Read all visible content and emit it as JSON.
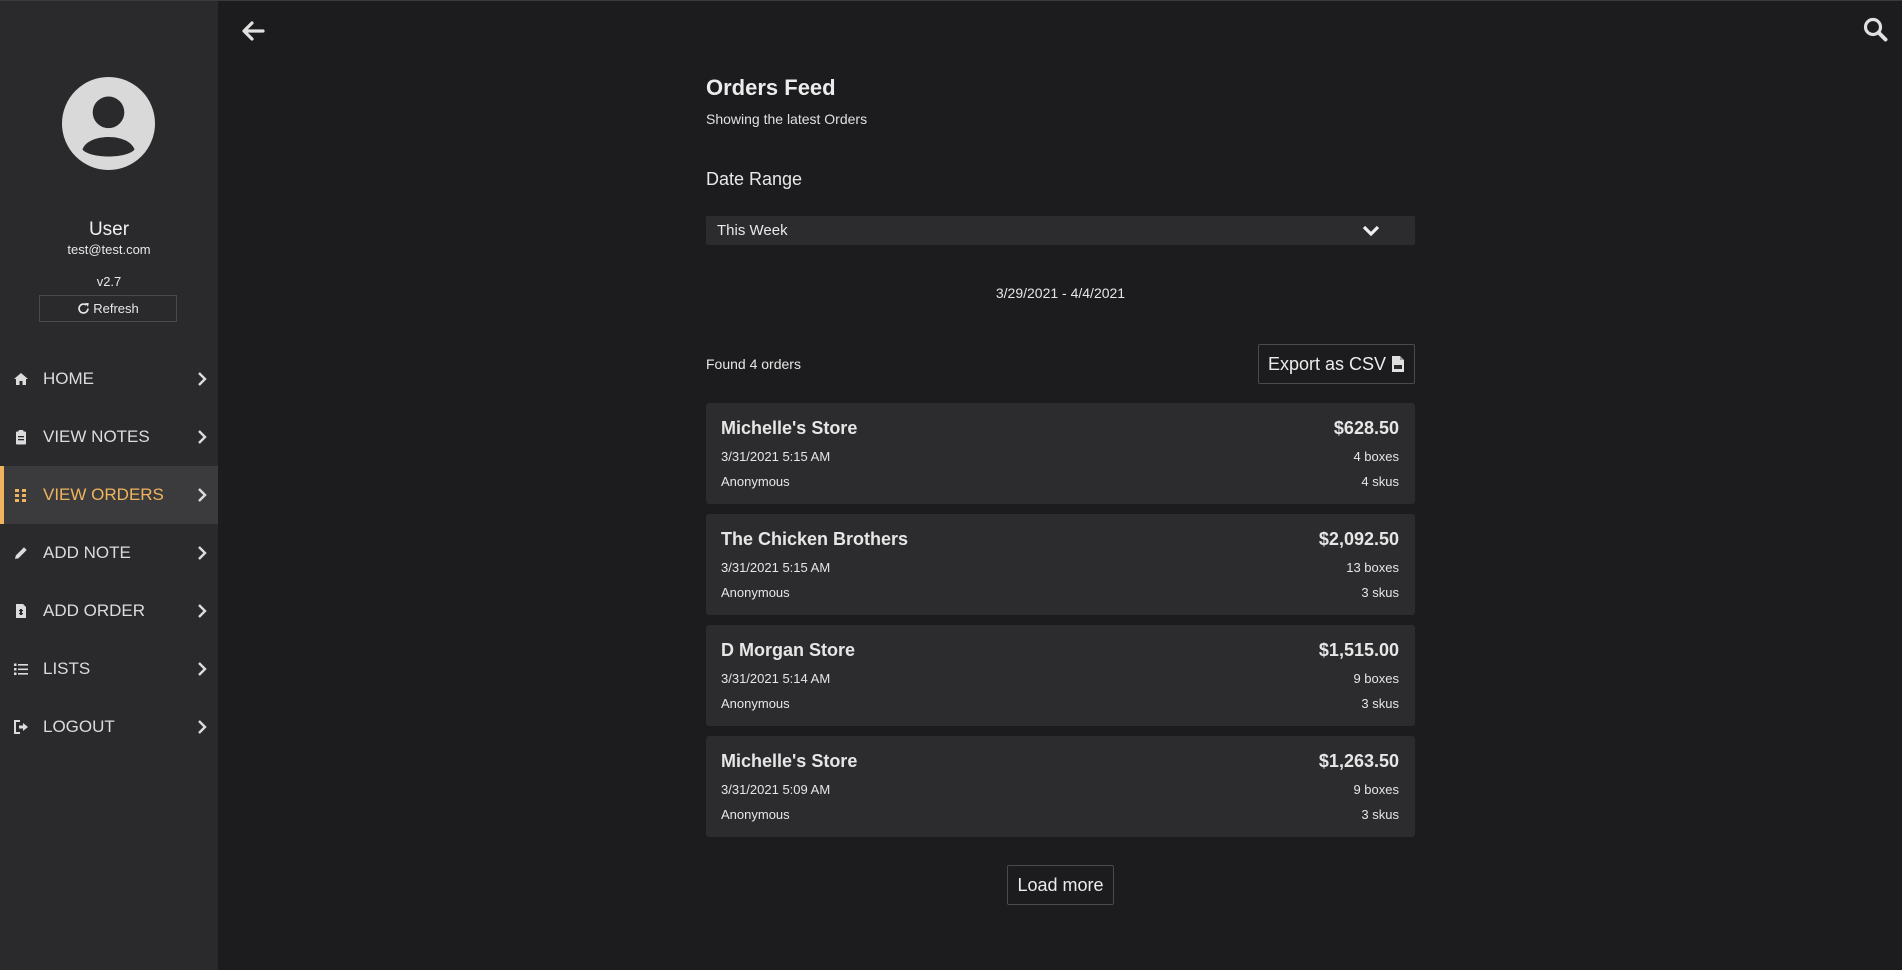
{
  "user": {
    "name": "User",
    "email": "test@test.com",
    "version": "v2.7",
    "refresh_label": "Refresh"
  },
  "nav": {
    "items": [
      {
        "label": "HOME",
        "icon": "home-icon"
      },
      {
        "label": "VIEW NOTES",
        "icon": "clipboard-icon"
      },
      {
        "label": "VIEW ORDERS",
        "icon": "grid-icon",
        "active": true
      },
      {
        "label": "ADD NOTE",
        "icon": "pencil-icon"
      },
      {
        "label": "ADD ORDER",
        "icon": "file-invoice-icon"
      },
      {
        "label": "LISTS",
        "icon": "list-icon"
      },
      {
        "label": "LOGOUT",
        "icon": "sign-out-icon"
      }
    ]
  },
  "header": {
    "back_icon": "arrow-left-icon",
    "search_icon": "search-icon"
  },
  "feed": {
    "title": "Orders Feed",
    "subtitle": "Showing the latest Orders",
    "date_range_label": "Date Range",
    "date_range_value": "This Week",
    "range_text": "3/29/2021 - 4/4/2021",
    "found_text": "Found 4 orders",
    "export_label": "Export as CSV",
    "load_more_label": "Load more"
  },
  "orders": [
    {
      "store": "Michelle's Store",
      "price": "$628.50",
      "date": "3/31/2021 5:15 AM",
      "boxes": "4 boxes",
      "author": "Anonymous",
      "skus": "4 skus"
    },
    {
      "store": "The Chicken Brothers",
      "price": "$2,092.50",
      "date": "3/31/2021 5:15 AM",
      "boxes": "13 boxes",
      "author": "Anonymous",
      "skus": "3 skus"
    },
    {
      "store": "D Morgan Store",
      "price": "$1,515.00",
      "date": "3/31/2021 5:14 AM",
      "boxes": "9 boxes",
      "author": "Anonymous",
      "skus": "3 skus"
    },
    {
      "store": "Michelle's Store",
      "price": "$1,263.50",
      "date": "3/31/2021 5:09 AM",
      "boxes": "9 boxes",
      "author": "Anonymous",
      "skus": "3 skus"
    }
  ],
  "colors": {
    "accent": "#f0b45e",
    "background": "#1c1c1e",
    "sidebar": "#2a2a2c",
    "card": "#2c2c2e"
  }
}
